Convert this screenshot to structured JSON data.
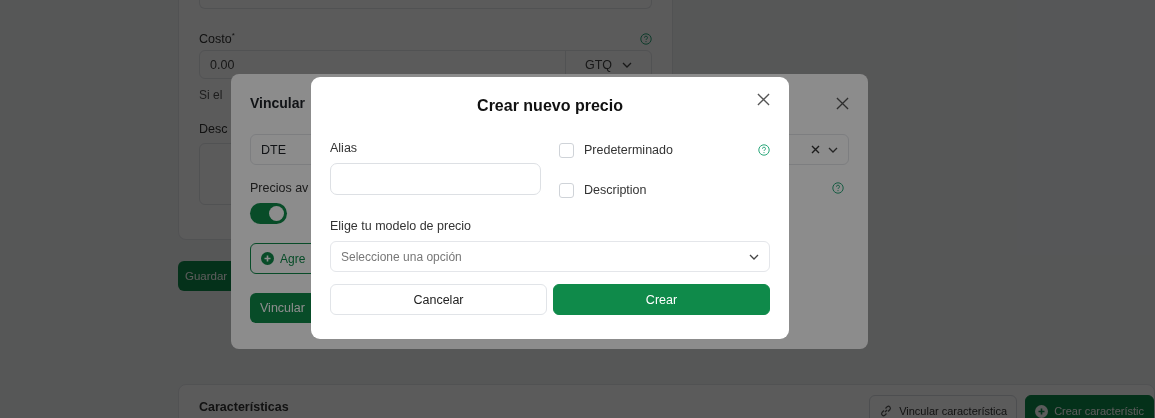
{
  "page": {
    "cost": {
      "label": "Costo",
      "required_mark": "*",
      "value": "0.00",
      "currency": "GTQ",
      "hint": "Si el"
    },
    "description_label": "Desc",
    "save_button": "Guardar",
    "characteristics": {
      "title": "Características",
      "buttons": [
        {
          "kind": "link",
          "label": "Vincular característica"
        },
        {
          "kind": "create",
          "label": "Crear característic"
        }
      ]
    }
  },
  "link_dialog": {
    "title": "Vincular",
    "select_value": "DTE",
    "prices_label": "Precios av",
    "prices_toggle_on": true,
    "add_button": "Agre",
    "link_button": "Vincular"
  },
  "price_dialog": {
    "title": "Crear nuevo precio",
    "alias_label": "Alias",
    "options": [
      {
        "label": "Predeterminado",
        "checked": false,
        "help": true
      },
      {
        "label": "Description",
        "checked": false,
        "help": false
      }
    ],
    "model_label": "Elige tu modelo de precio",
    "model_placeholder": "Seleccione una opción",
    "buttons": [
      {
        "kind": "secondary",
        "label": "Cancelar"
      },
      {
        "kind": "primary",
        "label": "Crear"
      }
    ]
  }
}
